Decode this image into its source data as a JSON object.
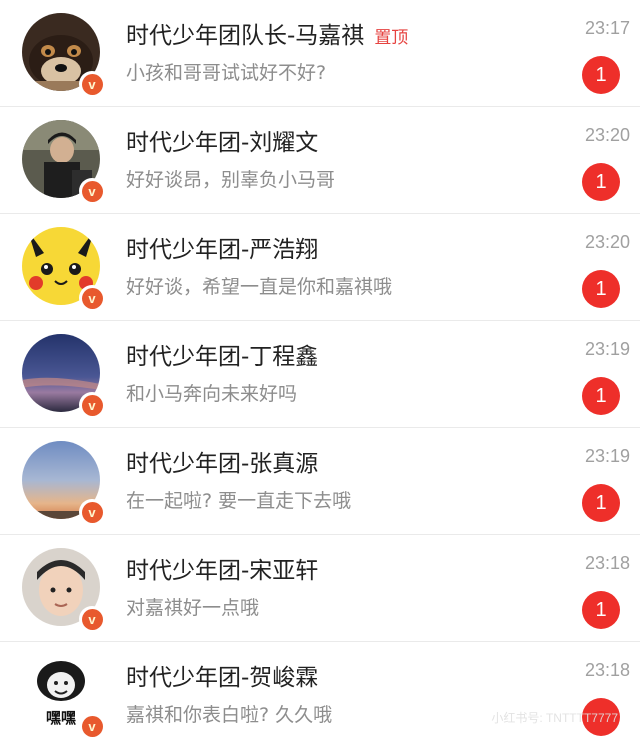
{
  "conversations": [
    {
      "name": "时代少年团队长-马嘉祺",
      "pinned_label": "置顶",
      "message": "小孩和哥哥试试好不好?",
      "time": "23:17",
      "unread": "1",
      "verified_glyph": "v"
    },
    {
      "name": "时代少年团-刘耀文",
      "message": "好好谈昂，别辜负小马哥",
      "time": "23:20",
      "unread": "1",
      "verified_glyph": "v"
    },
    {
      "name": "时代少年团-严浩翔",
      "message": "好好谈，希望一直是你和嘉祺哦",
      "time": "23:20",
      "unread": "1",
      "verified_glyph": "v"
    },
    {
      "name": "时代少年团-丁程鑫",
      "message": "和小马奔向未来好吗",
      "time": "23:19",
      "unread": "1",
      "verified_glyph": "v"
    },
    {
      "name": "时代少年团-张真源",
      "message": "在一起啦? 要一直走下去哦",
      "time": "23:19",
      "unread": "1",
      "verified_glyph": "v"
    },
    {
      "name": "时代少年团-宋亚轩",
      "message": "对嘉祺好一点哦",
      "time": "23:18",
      "unread": "1",
      "verified_glyph": "v"
    },
    {
      "name": "时代少年团-贺峻霖",
      "message": "嘉祺和你表白啦? 久久哦",
      "time": "23:18",
      "unread": "",
      "verified_glyph": "v",
      "avatar_caption": "嘿嘿"
    }
  ],
  "watermark": "小红书号: TNTTTT7777",
  "colors": {
    "accent": "#ee2f2a",
    "pin": "#e64340",
    "verified": "#e8592d"
  }
}
